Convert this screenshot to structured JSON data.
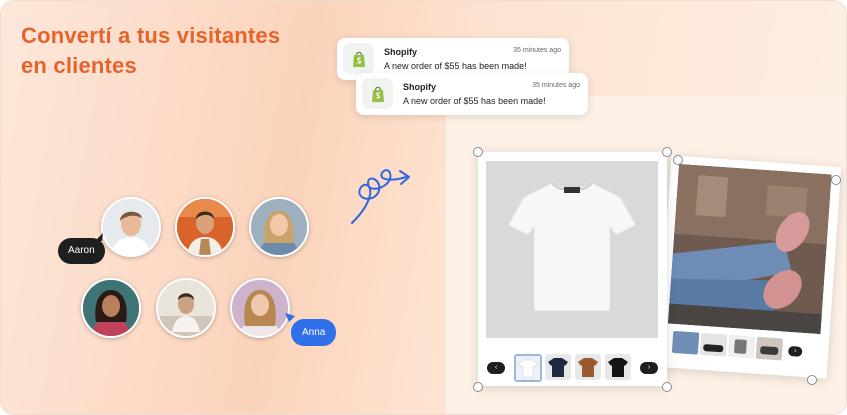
{
  "headline": {
    "line1": "Convertí a tus visitantes",
    "line2": "en clientes"
  },
  "notifications": [
    {
      "app": "Shopify",
      "time": "35 minutes ago",
      "message": "A new order of $55 has been made!"
    },
    {
      "app": "Shopify",
      "time": "35 minutes ago",
      "message": "A new order of $55 has been made!"
    }
  ],
  "visitors": {
    "labels": {
      "aaron": "Aaron",
      "anna": "Anna"
    }
  },
  "carousel": {
    "prev_icon": "chevron-left-icon",
    "next_icon": "chevron-right-icon"
  },
  "colors": {
    "headline": "#e5642c",
    "anna_bubble": "#2f6fe8",
    "aaron_bubble": "#1f1f1f",
    "shopify_green": "#95bf47"
  }
}
